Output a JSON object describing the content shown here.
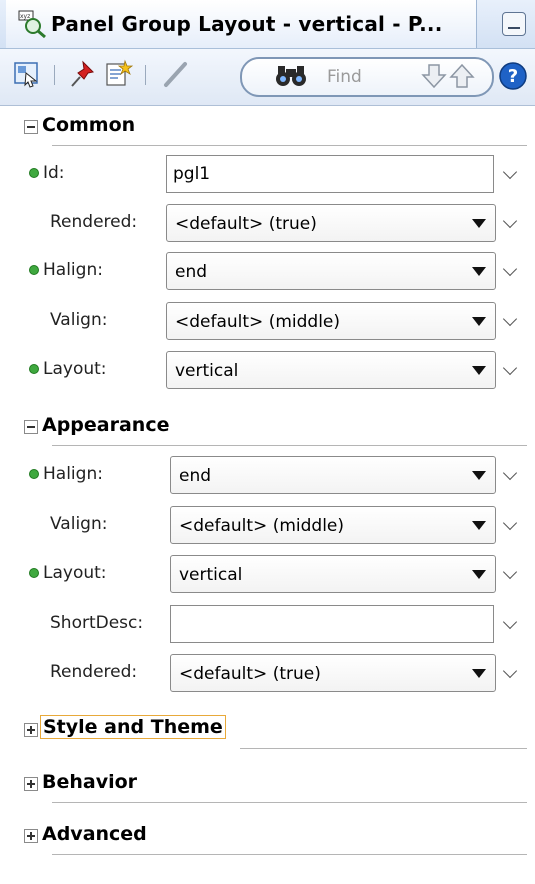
{
  "window": {
    "title": "Panel Group Layout - vertical - P..."
  },
  "toolbar": {
    "find_placeholder": "Find"
  },
  "icons": {
    "title": "properties-icon",
    "select": "select-component-icon",
    "pin": "pin-icon",
    "edit": "edit-properties-icon",
    "pencil": "pencil-icon",
    "binoculars": "binoculars-icon",
    "down": "arrow-down-icon",
    "up": "arrow-up-icon",
    "help": "help-icon"
  },
  "colors": {
    "accent": "#3fa83f",
    "focus": "#e8a93a",
    "help": "#1f62c6"
  },
  "sections": {
    "common": {
      "title": "Common",
      "props": {
        "id": {
          "label": "Id:",
          "value": "pgl1"
        },
        "rendered": {
          "label": "Rendered:",
          "value": "<default> (true)"
        },
        "halign": {
          "label": "Halign:",
          "value": "end"
        },
        "valign": {
          "label": "Valign:",
          "value": "<default> (middle)"
        },
        "layout": {
          "label": "Layout:",
          "value": "vertical"
        }
      }
    },
    "appearance": {
      "title": "Appearance",
      "props": {
        "halign": {
          "label": "Halign:",
          "value": "end"
        },
        "valign": {
          "label": "Valign:",
          "value": "<default> (middle)"
        },
        "layout": {
          "label": "Layout:",
          "value": "vertical"
        },
        "shortdesc": {
          "label": "ShortDesc:",
          "value": ""
        },
        "rendered": {
          "label": "Rendered:",
          "value": "<default> (true)"
        }
      }
    },
    "style": {
      "title": "Style and Theme"
    },
    "behavior": {
      "title": "Behavior"
    },
    "advanced": {
      "title": "Advanced"
    }
  }
}
